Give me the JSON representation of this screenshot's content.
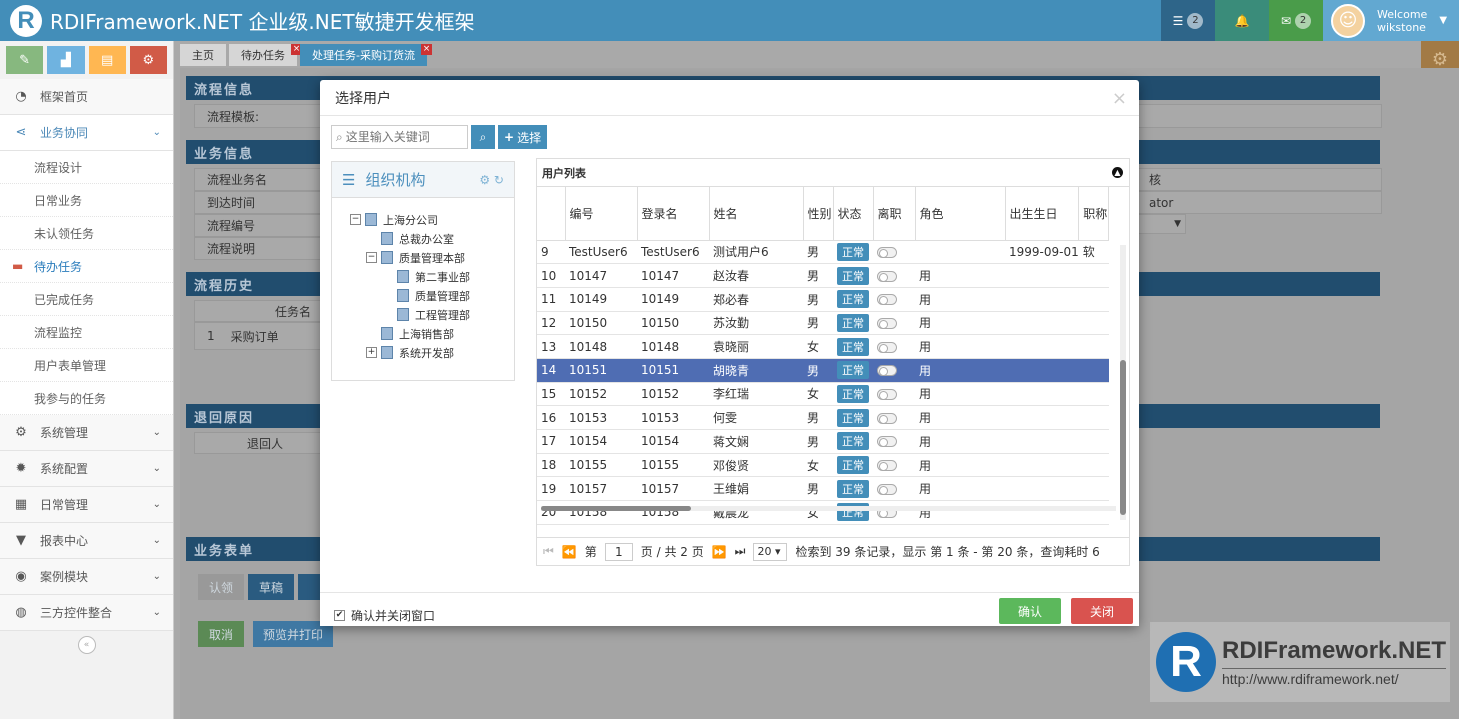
{
  "header": {
    "logo_letter": "R",
    "title": "RDIFramework.NET 企业级.NET敏捷开发框架",
    "tasks_count": "2",
    "mail_count": "2",
    "welcome": "Welcome",
    "username": "wikstone"
  },
  "sidebar": {
    "items": [
      {
        "label": "框架首页"
      },
      {
        "label": "业务协同"
      },
      {
        "label": "流程设计"
      },
      {
        "label": "日常业务"
      },
      {
        "label": "未认领任务"
      },
      {
        "label": "待办任务"
      },
      {
        "label": "已完成任务"
      },
      {
        "label": "流程监控"
      },
      {
        "label": "用户表单管理"
      },
      {
        "label": "我参与的任务"
      },
      {
        "label": "系统管理"
      },
      {
        "label": "系统配置"
      },
      {
        "label": "日常管理"
      },
      {
        "label": "报表中心"
      },
      {
        "label": "案例模块"
      },
      {
        "label": "三方控件整合"
      }
    ]
  },
  "tabs": [
    {
      "label": "主页"
    },
    {
      "label": "待办任务"
    },
    {
      "label": "处理任务-采购订货流"
    }
  ],
  "background": {
    "sec_flow_info": "流程信息",
    "flow_template": "流程模板:",
    "sec_biz_info": "业务信息",
    "biz_name": "流程业务名",
    "arrive_time": "到达时间",
    "flow_no": "流程编号",
    "flow_desc": "流程说明",
    "right_val1": "核",
    "right_val2": "ator",
    "sec_history": "流程历史",
    "task_name_col": "任务名",
    "hist_row_no": "1",
    "hist_row_name": "采购订单",
    "sec_return": "退回原因",
    "return_person": "退回人",
    "sec_form": "业务表单",
    "btn_approve": "认领",
    "btn_draft": "草稿",
    "btn_cancel": "取消",
    "btn_print": "预览并打印"
  },
  "watermark": {
    "letter": "R",
    "title": "RDIFramework.NET",
    "url": "http://www.rdiframework.net/"
  },
  "modal": {
    "title": "选择用户",
    "close": "×",
    "search_placeholder": "这里输入关键词",
    "select_btn": "选择",
    "org_title": "组织机构",
    "tree": [
      {
        "label": "上海分公司",
        "level": 0,
        "box": "−"
      },
      {
        "label": "总裁办公室",
        "level": 1,
        "box": ""
      },
      {
        "label": "质量管理本部",
        "level": 1,
        "box": "−"
      },
      {
        "label": "第二事业部",
        "level": 2,
        "box": ""
      },
      {
        "label": "质量管理部",
        "level": 2,
        "box": ""
      },
      {
        "label": "工程管理部",
        "level": 2,
        "box": ""
      },
      {
        "label": "上海销售部",
        "level": 1,
        "box": ""
      },
      {
        "label": "系统开发部",
        "level": 1,
        "box": "+"
      }
    ],
    "grid_caption": "用户列表",
    "columns": [
      "编号",
      "登录名",
      "姓名",
      "性别",
      "状态",
      "离职",
      "角色",
      "出生生日",
      "职称"
    ],
    "rows": [
      {
        "n": "9",
        "id": "TestUser6",
        "login": "TestUser6",
        "name": "测试用户6",
        "sex": "男",
        "status": "正常",
        "role": "",
        "birth": "1999-09-01",
        "title": "软"
      },
      {
        "n": "10",
        "id": "10147",
        "login": "10147",
        "name": "赵汝春",
        "sex": "男",
        "status": "正常",
        "role": "用",
        "birth": "",
        "title": ""
      },
      {
        "n": "11",
        "id": "10149",
        "login": "10149",
        "name": "郑必春",
        "sex": "男",
        "status": "正常",
        "role": "用",
        "birth": "",
        "title": ""
      },
      {
        "n": "12",
        "id": "10150",
        "login": "10150",
        "name": "苏汝勤",
        "sex": "男",
        "status": "正常",
        "role": "用",
        "birth": "",
        "title": ""
      },
      {
        "n": "13",
        "id": "10148",
        "login": "10148",
        "name": "袁晓丽",
        "sex": "女",
        "status": "正常",
        "role": "用",
        "birth": "",
        "title": ""
      },
      {
        "n": "14",
        "id": "10151",
        "login": "10151",
        "name": "胡晓青",
        "sex": "男",
        "status": "正常",
        "role": "用",
        "birth": "",
        "title": ""
      },
      {
        "n": "15",
        "id": "10152",
        "login": "10152",
        "name": "李红瑞",
        "sex": "女",
        "status": "正常",
        "role": "用",
        "birth": "",
        "title": ""
      },
      {
        "n": "16",
        "id": "10153",
        "login": "10153",
        "name": "何雯",
        "sex": "男",
        "status": "正常",
        "role": "用",
        "birth": "",
        "title": ""
      },
      {
        "n": "17",
        "id": "10154",
        "login": "10154",
        "name": "蒋文娴",
        "sex": "男",
        "status": "正常",
        "role": "用",
        "birth": "",
        "title": ""
      },
      {
        "n": "18",
        "id": "10155",
        "login": "10155",
        "name": "邓俊贤",
        "sex": "女",
        "status": "正常",
        "role": "用",
        "birth": "",
        "title": ""
      },
      {
        "n": "19",
        "id": "10157",
        "login": "10157",
        "name": "王维娟",
        "sex": "男",
        "status": "正常",
        "role": "用",
        "birth": "",
        "title": ""
      },
      {
        "n": "20",
        "id": "10158",
        "login": "10158",
        "name": "戴晨龙",
        "sex": "女",
        "status": "正常",
        "role": "用",
        "birth": "",
        "title": ""
      }
    ],
    "selected_row": "14",
    "pager": {
      "page_label": "第",
      "page": "1",
      "of_label": "页 / 共 2 页",
      "page_size": "20",
      "summary": "检索到 39 条记录，显示 第 1 条 - 第 20 条，查询耗时 6"
    },
    "confirm_close_label": "确认并关闭窗口",
    "ok_btn": "确认",
    "close_btn": "关闭"
  },
  "colors": {
    "primary": "#438eb9",
    "ok": "#5cb85c",
    "danger": "#d9534f",
    "selected": "#4f6db3"
  }
}
